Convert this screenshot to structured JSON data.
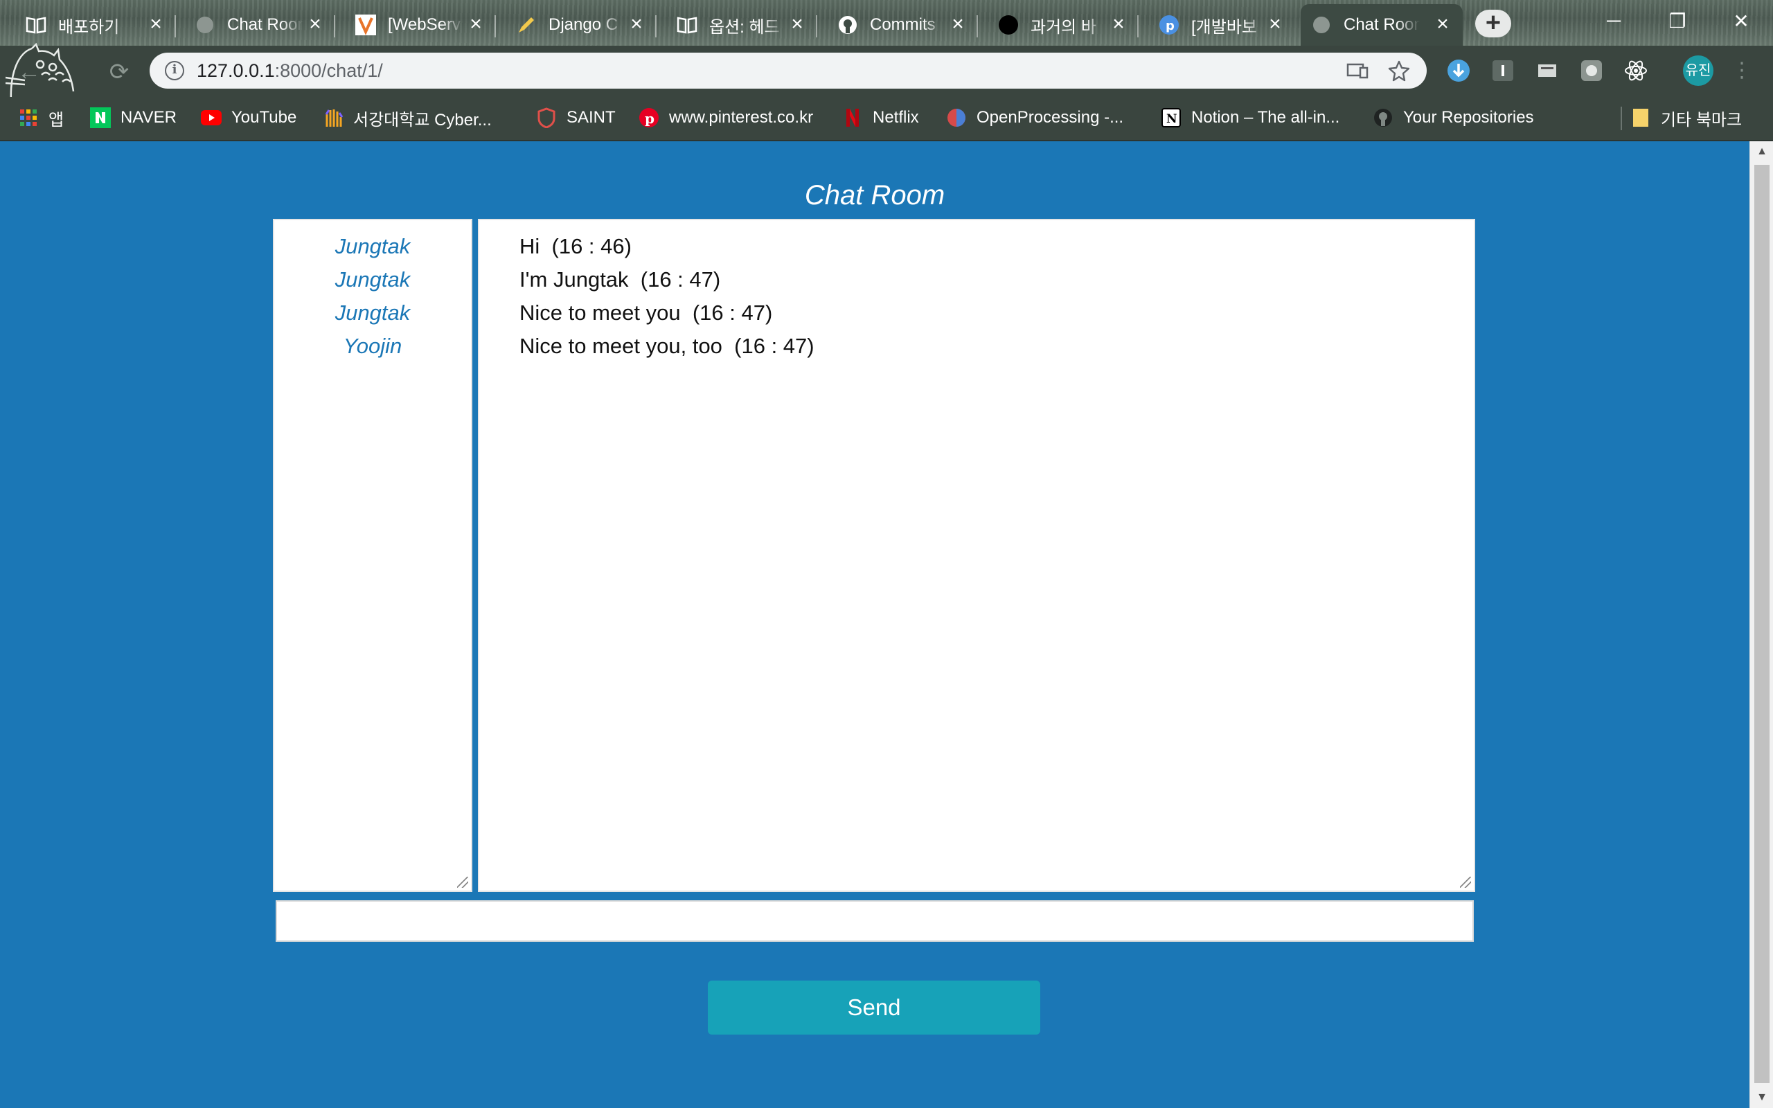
{
  "browser": {
    "tabs": [
      {
        "title": "배포하기",
        "icon": "book-icon",
        "active": false
      },
      {
        "title": "Chat Room",
        "icon": "globe-icon",
        "active": false
      },
      {
        "title": "[WebServ",
        "icon": "v-logo-icon",
        "active": false
      },
      {
        "title": "Django C",
        "icon": "pencil-icon",
        "active": false
      },
      {
        "title": "옵션: 헤드",
        "icon": "book-icon",
        "active": false
      },
      {
        "title": "Commits",
        "icon": "github-icon",
        "active": false
      },
      {
        "title": "과거의 바",
        "icon": "black-circle-icon",
        "active": false
      },
      {
        "title": "[개발바보",
        "icon": "p-logo-icon",
        "active": false
      },
      {
        "title": "Chat Room",
        "icon": "globe-icon",
        "active": true
      }
    ],
    "url_host": "127.0.0.1",
    "url_rest": ":8000/chat/1/",
    "profile_label": "유진",
    "bookmarks": [
      {
        "label": "앱",
        "icon": "apps-grid-icon"
      },
      {
        "label": "NAVER",
        "icon": "naver-icon"
      },
      {
        "label": "YouTube",
        "icon": "youtube-icon"
      },
      {
        "label": "서강대학교 Cyber...",
        "icon": "hand-icon"
      },
      {
        "label": "SAINT",
        "icon": "shield-icon"
      },
      {
        "label": "www.pinterest.co.kr",
        "icon": "pinterest-icon"
      },
      {
        "label": "Netflix",
        "icon": "netflix-icon"
      },
      {
        "label": "OpenProcessing -...",
        "icon": "openprocessing-icon"
      },
      {
        "label": "Notion – The all-in...",
        "icon": "notion-icon"
      },
      {
        "label": "Your Repositories",
        "icon": "github-icon"
      }
    ],
    "other_bookmarks": "기타 북마크"
  },
  "page": {
    "title": "Chat Room",
    "users": [
      "Jungtak",
      "Jungtak",
      "Jungtak",
      "Yoojin"
    ],
    "messages": [
      "Hi  (16 : 46)",
      "I'm Jungtak  (16 : 47)",
      "Nice to meet you  (16 : 47)",
      "Nice to meet you, too  (16 : 47)"
    ],
    "message_input_value": "",
    "send_label": "Send"
  },
  "colors": {
    "page_background": "#1b77b6",
    "send_button": "#17a2b8",
    "username_text": "#1b77b6"
  }
}
